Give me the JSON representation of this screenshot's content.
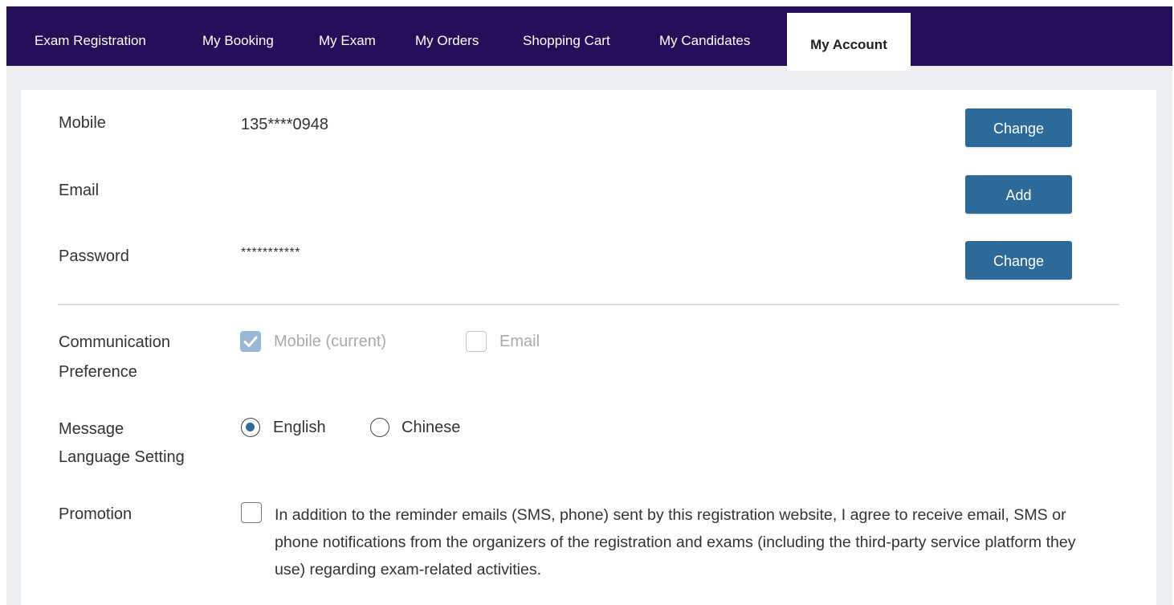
{
  "nav": {
    "tabs": [
      {
        "label": "Exam Registration"
      },
      {
        "label": "My Booking"
      },
      {
        "label": "My Exam"
      },
      {
        "label": "My Orders"
      },
      {
        "label": "Shopping Cart"
      },
      {
        "label": "My Candidates"
      },
      {
        "label": "My Account"
      }
    ],
    "active_tab": "My Account",
    "bg_color": "#260e5b"
  },
  "account": {
    "mobile": {
      "label": "Mobile",
      "value": "135****0948",
      "button": "Change"
    },
    "email": {
      "label": "Email",
      "value": "",
      "button": "Add"
    },
    "password": {
      "label": "Password",
      "value": "***********",
      "button": "Change"
    }
  },
  "preferences": {
    "communication": {
      "label_line1": "Communication",
      "label_line2": "Preference",
      "options": [
        {
          "label": "Mobile (current)",
          "checked": true,
          "disabled": true
        },
        {
          "label": "Email",
          "checked": false,
          "disabled": true
        }
      ]
    },
    "language": {
      "label_line1": "Message",
      "label_line2": "Language Setting",
      "options": [
        {
          "label": "English",
          "selected": true
        },
        {
          "label": "Chinese",
          "selected": false
        }
      ]
    },
    "promotion": {
      "label": "Promotion",
      "checked": false,
      "text": "In addition to the reminder emails (SMS, phone) sent by this registration website, I agree to receive email, SMS or phone notifications from the organizers of the registration and exams (including the third-party service platform they use) regarding exam-related activities."
    }
  },
  "colors": {
    "button": "#2d6a99",
    "page_background": "#ebeef0"
  }
}
